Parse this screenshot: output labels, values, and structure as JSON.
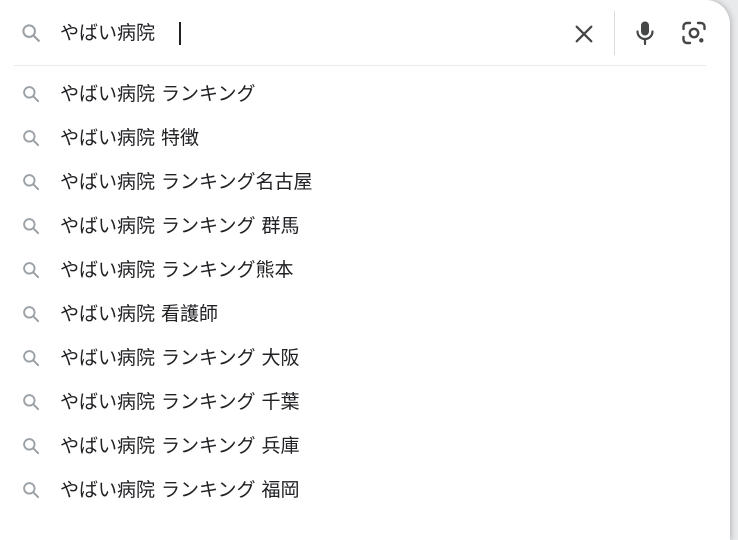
{
  "search": {
    "query": "やばい病院",
    "icon": "search-icon",
    "clear_icon": "close-icon",
    "voice_icon": "microphone-icon",
    "lens_icon": "camera-lens-icon"
  },
  "suggestions": [
    {
      "text": "やばい病院 ランキング",
      "icon": "search-icon"
    },
    {
      "text": "やばい病院 特徴",
      "icon": "search-icon"
    },
    {
      "text": "やばい病院 ランキング名古屋",
      "icon": "search-icon"
    },
    {
      "text": "やばい病院 ランキング 群馬",
      "icon": "search-icon"
    },
    {
      "text": "やばい病院 ランキング熊本",
      "icon": "search-icon"
    },
    {
      "text": "やばい病院 看護師",
      "icon": "search-icon"
    },
    {
      "text": "やばい病院 ランキング 大阪",
      "icon": "search-icon"
    },
    {
      "text": "やばい病院 ランキング 千葉",
      "icon": "search-icon"
    },
    {
      "text": "やばい病院 ランキング 兵庫",
      "icon": "search-icon"
    },
    {
      "text": "やばい病院 ランキング 福岡",
      "icon": "search-icon"
    }
  ],
  "colors": {
    "text": "#202124",
    "icon_gray": "#9aa0a6",
    "icon_dark": "#444746",
    "divider": "#dadce0"
  }
}
